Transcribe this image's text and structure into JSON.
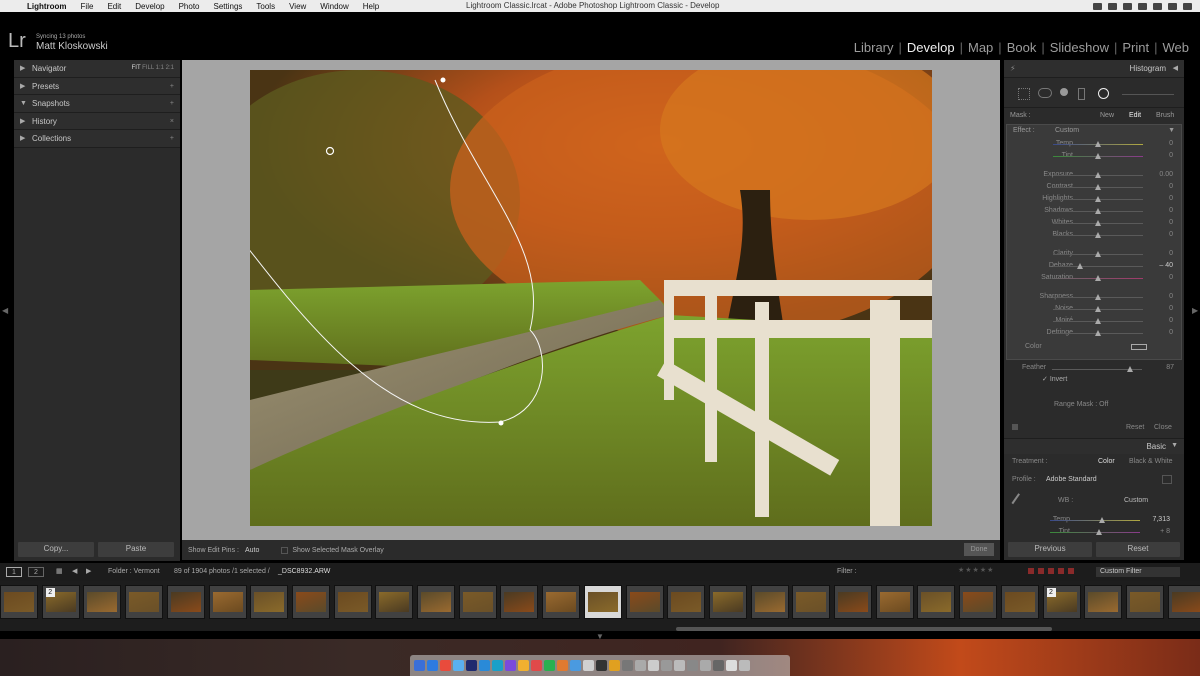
{
  "menubar": {
    "app_name": "Lightroom",
    "items": [
      "File",
      "Edit",
      "Develop",
      "Photo",
      "Settings",
      "Tools",
      "View",
      "Window",
      "Help"
    ],
    "window_title": "Lightroom Classic.lrcat - Adobe Photoshop Lightroom Classic - Develop"
  },
  "header": {
    "logo": "Lr",
    "sync_status": "Syncing 13 photos",
    "user_name": "Matt Kloskowski",
    "modules": [
      "Library",
      "Develop",
      "Map",
      "Book",
      "Slideshow",
      "Print",
      "Web"
    ],
    "active_module": "Develop"
  },
  "left_panel": {
    "navigator": {
      "label": "Navigator",
      "zoom_options": [
        "FIT",
        "FILL",
        "1:1",
        "2:1"
      ]
    },
    "sections": [
      {
        "label": "Presets",
        "action": "+"
      },
      {
        "label": "Snapshots",
        "action": "+"
      },
      {
        "label": "History",
        "action": "×"
      },
      {
        "label": "Collections",
        "action": "+"
      }
    ],
    "copy_label": "Copy...",
    "paste_label": "Paste"
  },
  "toolbar": {
    "show_edit_pins_label": "Show Edit Pins :",
    "show_edit_pins_value": "Auto",
    "overlay_label": "Show Selected Mask Overlay",
    "done_label": "Done"
  },
  "right_panel": {
    "histogram_label": "Histogram",
    "mask": {
      "label": "Mask :",
      "new": "New",
      "edit": "Edit",
      "brush": "Brush"
    },
    "effect": {
      "label": "Effect :",
      "value": "Custom"
    },
    "sliders": [
      {
        "label": "Temp",
        "value": "0",
        "pos": 0.5
      },
      {
        "label": "Tint",
        "value": "0",
        "pos": 0.5
      },
      {
        "label": "Exposure",
        "value": "0.00",
        "pos": 0.5
      },
      {
        "label": "Contrast",
        "value": "0",
        "pos": 0.5
      },
      {
        "label": "Highlights",
        "value": "0",
        "pos": 0.5
      },
      {
        "label": "Shadows",
        "value": "0",
        "pos": 0.5
      },
      {
        "label": "Whites",
        "value": "0",
        "pos": 0.5
      },
      {
        "label": "Blacks",
        "value": "0",
        "pos": 0.5
      },
      {
        "label": "Clarity",
        "value": "0",
        "pos": 0.5
      },
      {
        "label": "Dehaze",
        "value": "– 40",
        "pos": 0.3
      },
      {
        "label": "Saturation",
        "value": "0",
        "pos": 0.5
      },
      {
        "label": "Sharpness",
        "value": "0",
        "pos": 0.5
      },
      {
        "label": "Noise",
        "value": "0",
        "pos": 0.5
      },
      {
        "label": "Moiré",
        "value": "0",
        "pos": 0.5
      },
      {
        "label": "Defringe",
        "value": "0",
        "pos": 0.5
      }
    ],
    "color_label": "Color",
    "feather": {
      "label": "Feather",
      "value": "87",
      "pos": 0.87
    },
    "invert_label": "Invert",
    "range_mask_label": "Range Mask :",
    "range_mask_value": "Off",
    "reset_label": "Reset",
    "close_label": "Close",
    "basic_label": "Basic",
    "treatment": {
      "label": "Treatment :",
      "color": "Color",
      "bw": "Black & White"
    },
    "profile": {
      "label": "Profile :",
      "value": "Adobe Standard"
    },
    "wb": {
      "label": "WB :",
      "value": "Custom"
    },
    "temp": {
      "label": "Temp",
      "value": "7,313"
    },
    "tint": {
      "label": "Tint",
      "value": "+ 8"
    },
    "previous_label": "Previous",
    "reset_bottom_label": "Reset"
  },
  "filmbar": {
    "pages": [
      "1",
      "2"
    ],
    "folder": "Folder : Vermont",
    "count": "89 of 1904 photos /1 selected /",
    "filename": "_DSC8932.ARW",
    "filter_label": "Filter :",
    "custom_filter": "Custom Filter"
  },
  "filmstrip": {
    "badges": [
      "2",
      "2"
    ]
  },
  "colors": {
    "accent": "#f0f0f0",
    "panel": "#2b2b2b",
    "canvas": "#a5a5a5"
  }
}
